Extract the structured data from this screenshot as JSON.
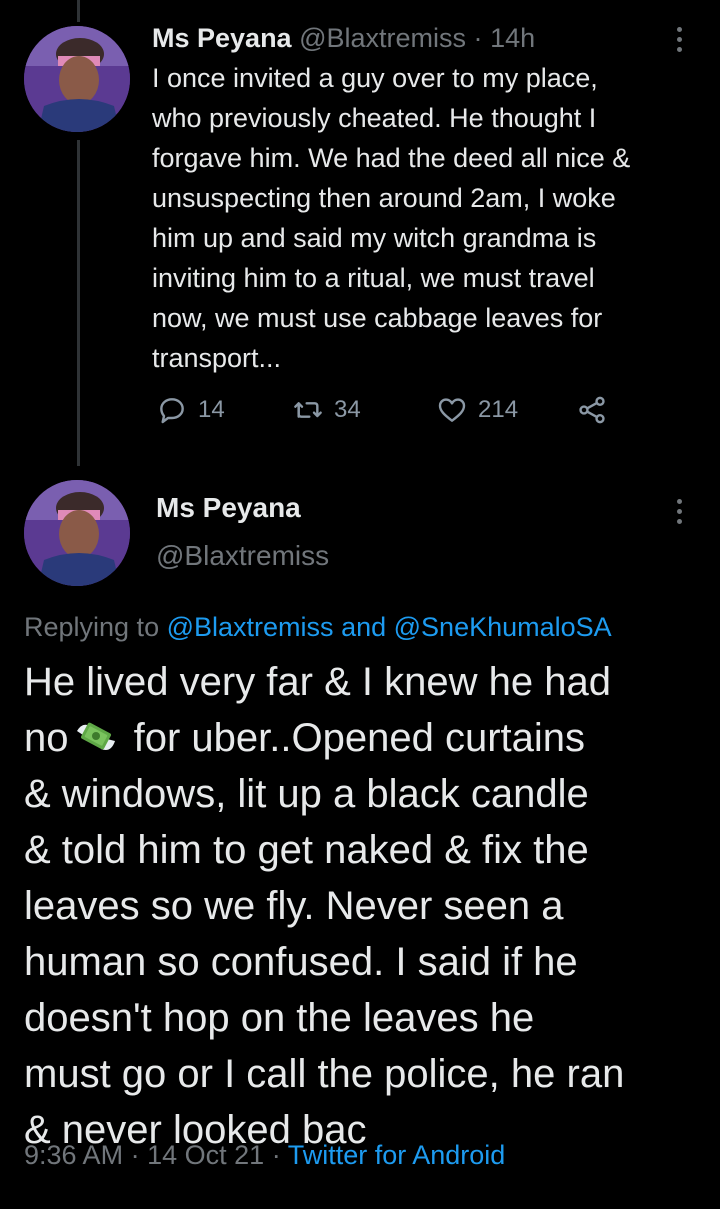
{
  "tweet1": {
    "name": "Ms Peyana",
    "handle": "@Blaxtremiss",
    "separator": "·",
    "time": "14h",
    "lines": [
      "I once invited a guy over to my place,",
      "who previously cheated. He thought I",
      "forgave him. We had the deed all nice &",
      "unsuspecting then around 2am, I woke",
      "him up and said my witch grandma is",
      "inviting him to a ritual, we must travel",
      "now, we must use cabbage leaves for",
      "transport..."
    ],
    "replies": "14",
    "retweets": "34",
    "likes": "214"
  },
  "tweet2": {
    "name": "Ms Peyana",
    "handle": "@Blaxtremiss",
    "replying_prefix": "Replying to",
    "mention1": "@Blaxtremiss",
    "and_word": "and",
    "mention2": "@SneKhumaloSA",
    "lines": [
      "He lived very far & I knew he had",
      "no",
      "for uber..Opened curtains",
      "& windows, lit up a black candle",
      "& told him to get naked & fix the",
      "leaves so we fly. Never seen a",
      "human so confused. I said if he",
      "doesn't hop on the leaves he",
      "must go or I call the police, he ran",
      "& never looked bac"
    ],
    "emoji": "money-with-wings-icon",
    "footer_time": "9:36 AM",
    "footer_dot": "·",
    "footer_date": "14 Oct 21",
    "footer_dot2": "·",
    "footer_source": "Twitter for Android"
  },
  "colors": {
    "background": "#000000",
    "text": "#e7e9ea",
    "secondary": "#71767b",
    "link": "#1d9bf0"
  },
  "icons": [
    "more-vertical-icon",
    "reply-icon",
    "retweet-icon",
    "like-icon",
    "share-icon"
  ]
}
